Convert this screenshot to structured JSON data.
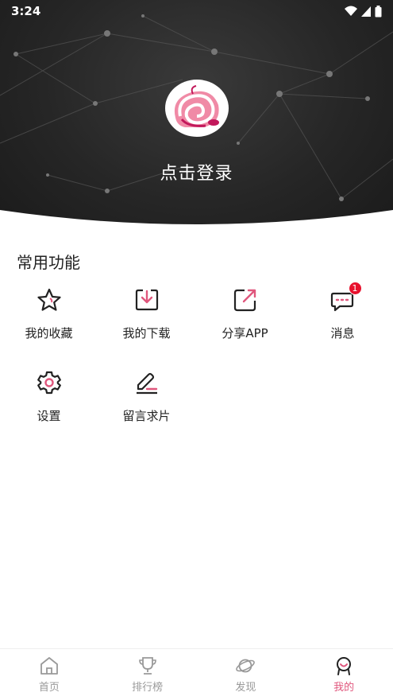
{
  "status": {
    "time": "3:24"
  },
  "header": {
    "login_text": "点击登录",
    "avatar_icon": "snail-logo-icon"
  },
  "section": {
    "title": "常用功能",
    "items": [
      {
        "label": "我的收藏",
        "icon": "star-icon"
      },
      {
        "label": "我的下载",
        "icon": "download-icon"
      },
      {
        "label": "分享APP",
        "icon": "share-icon"
      },
      {
        "label": "消息",
        "icon": "message-icon",
        "badge": "1"
      },
      {
        "label": "设置",
        "icon": "gear-icon"
      },
      {
        "label": "留言求片",
        "icon": "edit-icon"
      }
    ]
  },
  "nav": {
    "tabs": [
      {
        "label": "首页",
        "icon": "home-icon"
      },
      {
        "label": "排行榜",
        "icon": "trophy-icon"
      },
      {
        "label": "发现",
        "icon": "planet-icon"
      },
      {
        "label": "我的",
        "icon": "profile-icon",
        "active": true
      }
    ]
  },
  "colors": {
    "accent": "#e0577d",
    "header_bg": "#262626",
    "badge": "#e8112d"
  }
}
